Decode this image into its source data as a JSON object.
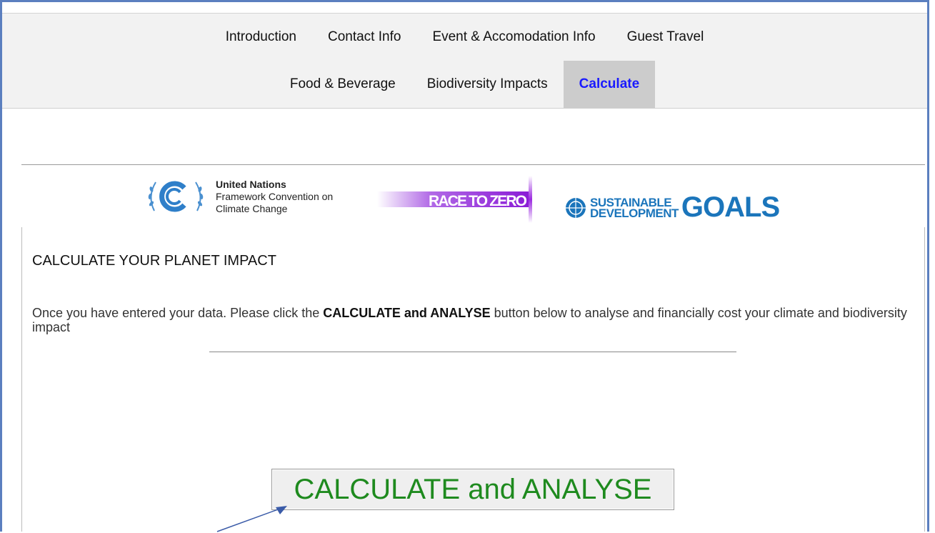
{
  "nav": {
    "row1": [
      "Introduction",
      "Contact Info",
      "Event & Accomodation Info",
      "Guest Travel"
    ],
    "row2": [
      "Food & Beverage",
      "Biodiversity Impacts",
      "Calculate"
    ],
    "active": "Calculate"
  },
  "logos": {
    "unfccc": {
      "line1": "United Nations",
      "line2": "Framework Convention on",
      "line3": "Climate Change"
    },
    "race_to_zero": "RACE TO ZERO",
    "sdg": {
      "small1": "SUSTAINABLE",
      "small2": "DEVELOPMENT",
      "goals": "GOALS"
    }
  },
  "main": {
    "heading": "CALCULATE YOUR PLANET IMPACT",
    "para_before": "Once you have entered your data. Please click the ",
    "para_bold": "CALCULATE and ANALYSE",
    "para_after": " button below to analyse and financially cost your climate and biodiversity impact",
    "button_label": "CALCULATE and ANALYSE"
  },
  "colors": {
    "accent_blue": "#1a1aff",
    "button_text": "#1e8a1e",
    "sdg_blue": "#1b75bb",
    "frame_border": "#5b7fbf"
  }
}
